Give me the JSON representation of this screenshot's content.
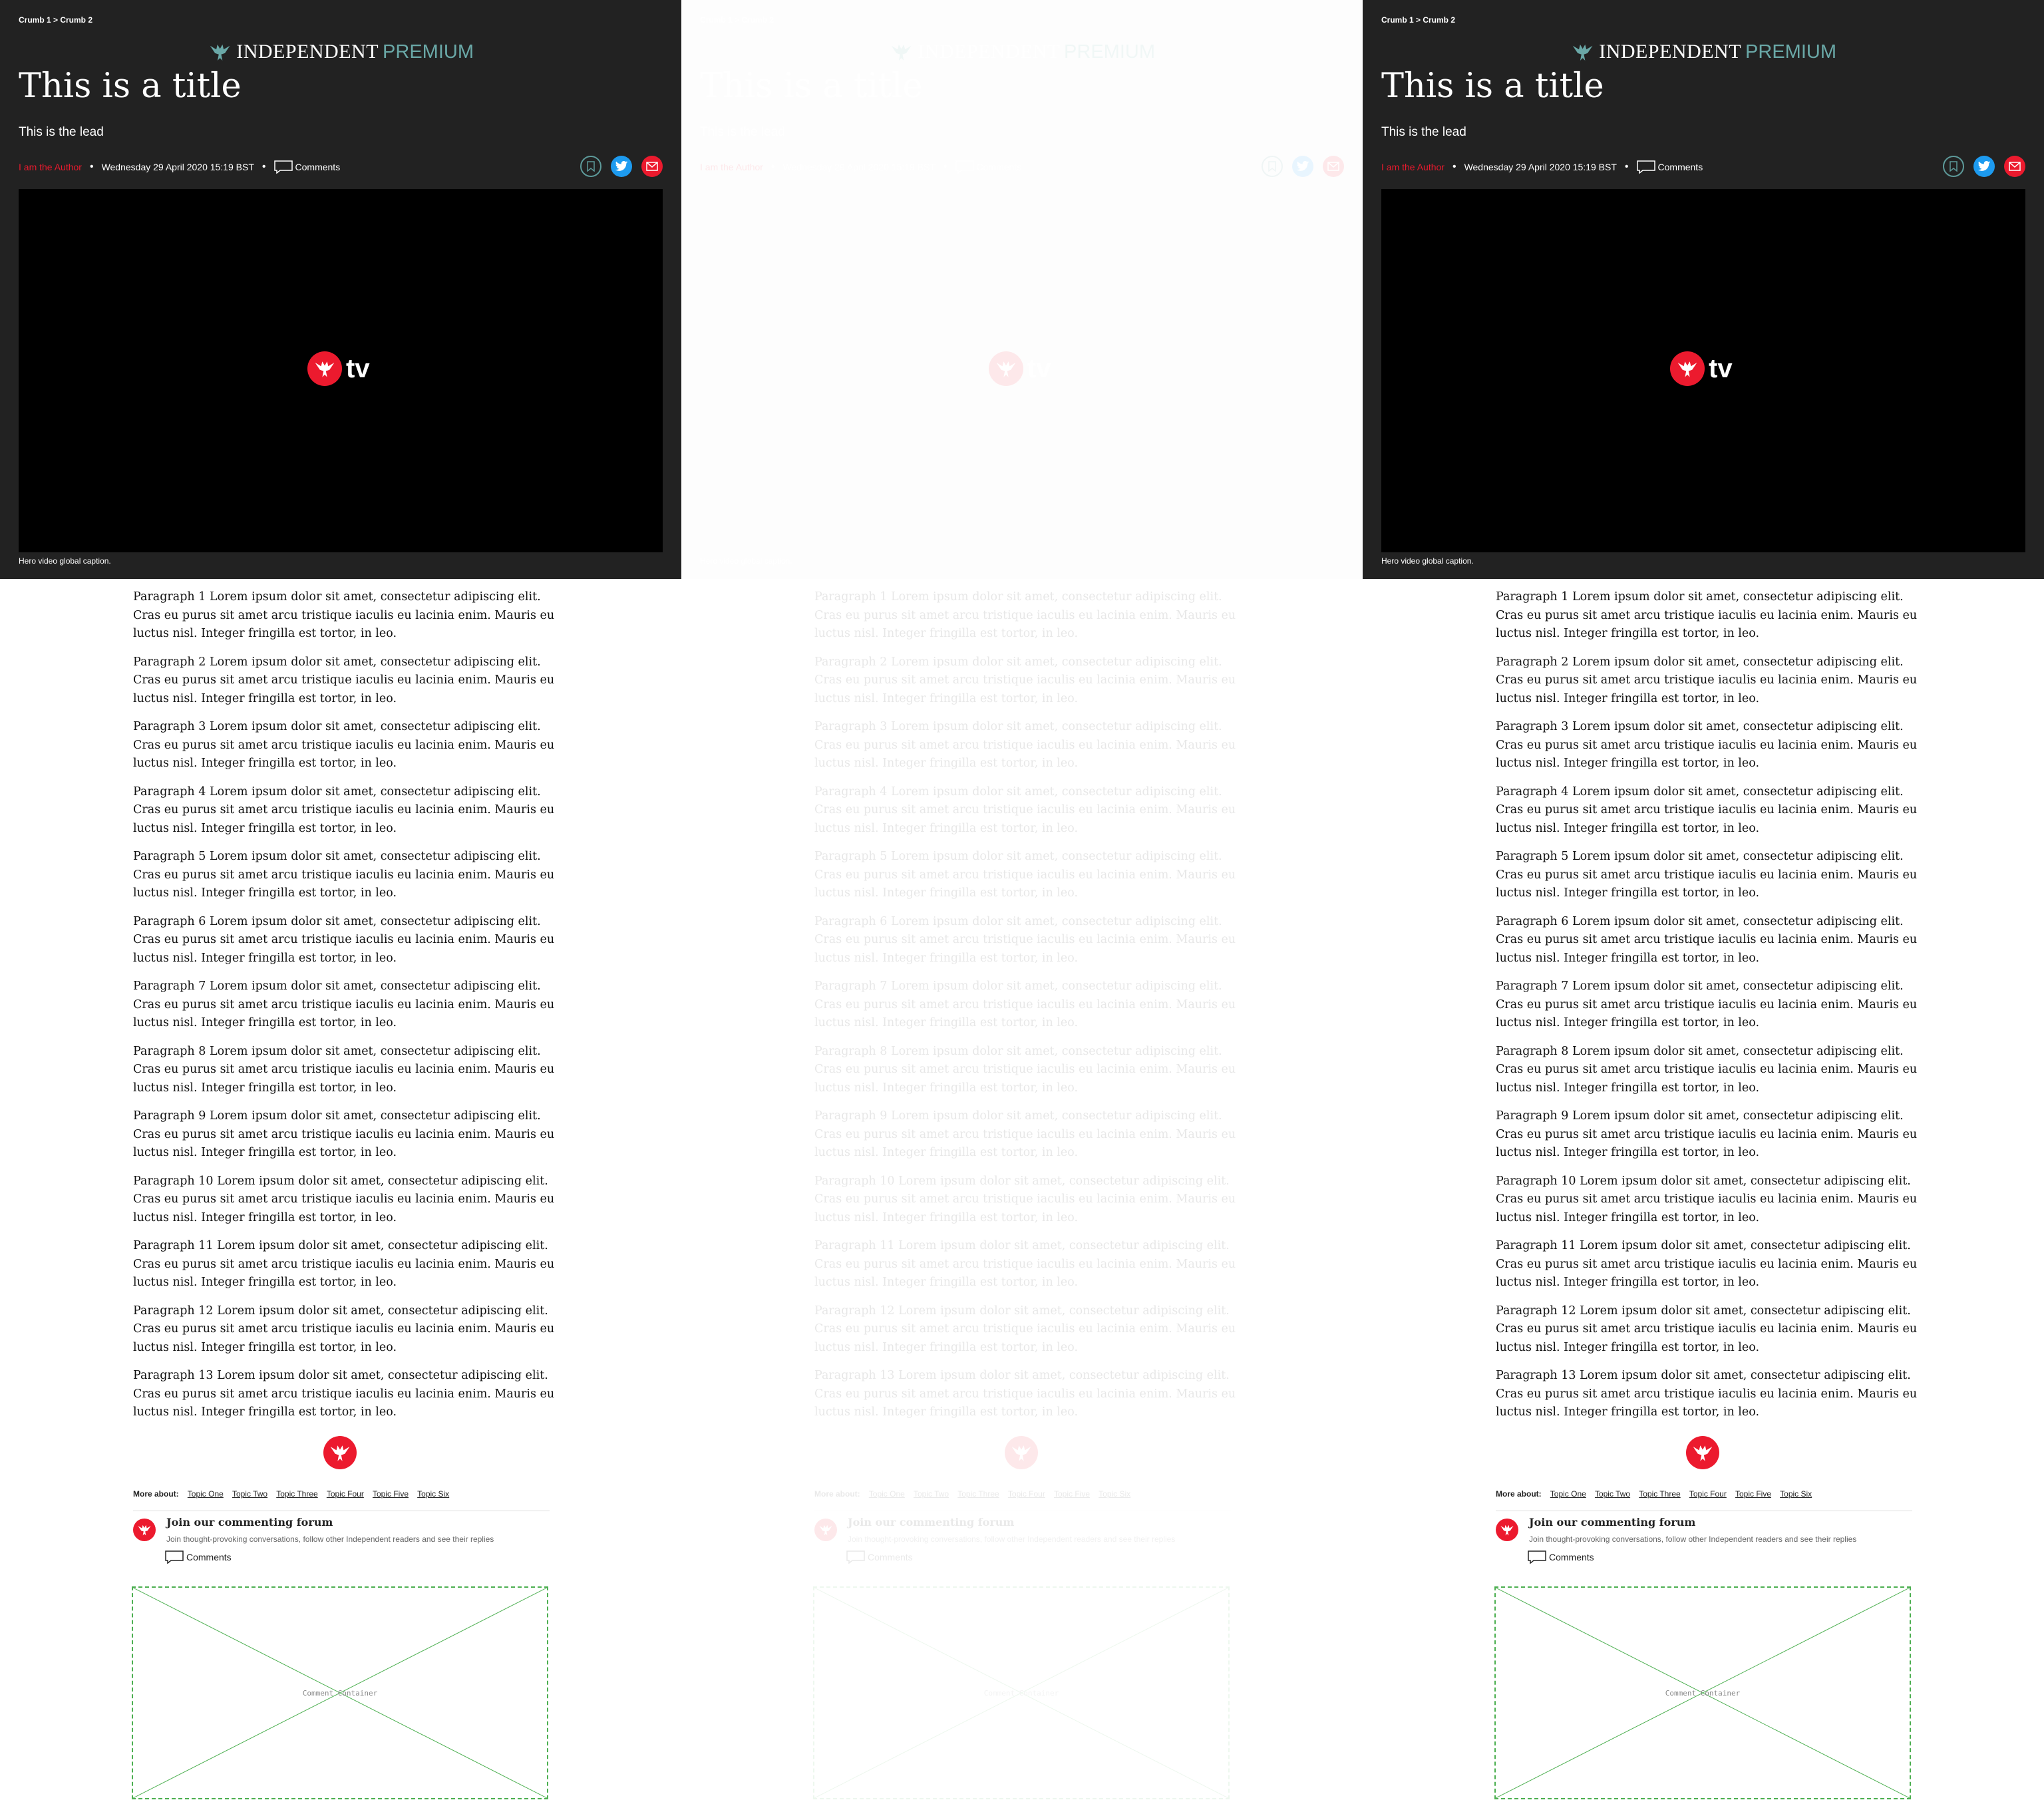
{
  "breadcrumb": "Crumb 1 > Crumb 2",
  "logo": {
    "main": "INDEPENDENT",
    "premium": "PREMIUM"
  },
  "title": "This is a title",
  "lead": "This is the lead",
  "byline": {
    "author": "I am the Author",
    "date": "Wednesday 29 April 2020 15:19 BST",
    "comments": "Comments"
  },
  "share": {
    "bookmark_icon": "bookmark-icon",
    "twitter_icon": "twitter-icon",
    "email_icon": "email-icon"
  },
  "video": {
    "tv_label": "tv",
    "caption": "Hero video global caption."
  },
  "paragraphs": [
    "Paragraph 1 Lorem ipsum dolor sit amet, consectetur adipiscing elit. Cras eu purus sit amet arcu tristique iaculis eu lacinia enim. Mauris eu luctus nisl. Integer fringilla est tortor, in leo.",
    "Paragraph 2 Lorem ipsum dolor sit amet, consectetur adipiscing elit. Cras eu purus sit amet arcu tristique iaculis eu lacinia enim. Mauris eu luctus nisl. Integer fringilla est tortor, in leo.",
    "Paragraph 3 Lorem ipsum dolor sit amet, consectetur adipiscing elit. Cras eu purus sit amet arcu tristique iaculis eu lacinia enim. Mauris eu luctus nisl. Integer fringilla est tortor, in leo.",
    "Paragraph 4 Lorem ipsum dolor sit amet, consectetur adipiscing elit. Cras eu purus sit amet arcu tristique iaculis eu lacinia enim. Mauris eu luctus nisl. Integer fringilla est tortor, in leo.",
    "Paragraph 5 Lorem ipsum dolor sit amet, consectetur adipiscing elit. Cras eu purus sit amet arcu tristique iaculis eu lacinia enim. Mauris eu luctus nisl. Integer fringilla est tortor, in leo.",
    "Paragraph 6 Lorem ipsum dolor sit amet, consectetur adipiscing elit. Cras eu purus sit amet arcu tristique iaculis eu lacinia enim. Mauris eu luctus nisl. Integer fringilla est tortor, in leo.",
    "Paragraph 7 Lorem ipsum dolor sit amet, consectetur adipiscing elit. Cras eu purus sit amet arcu tristique iaculis eu lacinia enim. Mauris eu luctus nisl. Integer fringilla est tortor, in leo.",
    "Paragraph 8 Lorem ipsum dolor sit amet, consectetur adipiscing elit. Cras eu purus sit amet arcu tristique iaculis eu lacinia enim. Mauris eu luctus nisl. Integer fringilla est tortor, in leo.",
    "Paragraph 9 Lorem ipsum dolor sit amet, consectetur adipiscing elit. Cras eu purus sit amet arcu tristique iaculis eu lacinia enim. Mauris eu luctus nisl. Integer fringilla est tortor, in leo.",
    "Paragraph 10 Lorem ipsum dolor sit amet, consectetur adipiscing elit. Cras eu purus sit amet arcu tristique iaculis eu lacinia enim. Mauris eu luctus nisl. Integer fringilla est tortor, in leo.",
    "Paragraph 11 Lorem ipsum dolor sit amet, consectetur adipiscing elit. Cras eu purus sit amet arcu tristique iaculis eu lacinia enim. Mauris eu luctus nisl. Integer fringilla est tortor, in leo.",
    "Paragraph 12 Lorem ipsum dolor sit amet, consectetur adipiscing elit. Cras eu purus sit amet arcu tristique iaculis eu lacinia enim. Mauris eu luctus nisl. Integer fringilla est tortor, in leo.",
    "Paragraph 13 Lorem ipsum dolor sit amet, consectetur adipiscing elit. Cras eu purus sit amet arcu tristique iaculis eu lacinia enim. Mauris eu luctus nisl. Integer fringilla est tortor, in leo."
  ],
  "more_about": {
    "label": "More about:",
    "topics": [
      "Topic One",
      "Topic Two",
      "Topic Three",
      "Topic Four",
      "Topic Five",
      "Topic Six"
    ]
  },
  "forum": {
    "title": "Join our commenting forum",
    "description": "Join thought-provoking conversations, follow other Independent readers and see their replies",
    "comments": "Comments"
  },
  "comment_container": {
    "label": "Comment Container"
  },
  "colors": {
    "brand_red": "#ec1a2e",
    "premium_teal": "#6aa8a7",
    "hero_bg": "#222222",
    "twitter_blue": "#1d9bf0",
    "placeholder_green": "#4caf50"
  }
}
